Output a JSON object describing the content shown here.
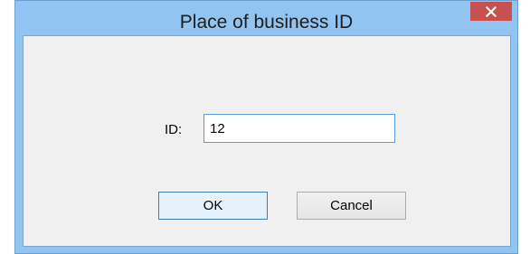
{
  "window": {
    "title": "Place of business ID",
    "close_icon": "close-icon"
  },
  "form": {
    "id_label": "ID:",
    "id_value": "12"
  },
  "buttons": {
    "ok_label": "OK",
    "cancel_label": "Cancel"
  },
  "colors": {
    "frame": "#92c4f2",
    "close_button": "#c75050",
    "client_background": "#f0f0f0",
    "input_focus_border": "#569de5"
  }
}
